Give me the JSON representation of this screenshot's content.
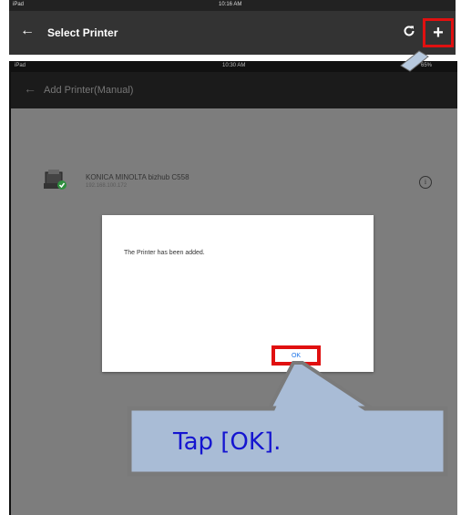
{
  "back_screen": {
    "status_left": "iPad",
    "status_time": "10:16 AM",
    "back_icon": "arrow-left-icon",
    "title": "Select Printer",
    "refresh_icon": "refresh-icon",
    "add_label": "+"
  },
  "front_screen": {
    "status_left": "iPad",
    "status_time": "10:30 AM",
    "status_right": "65%",
    "back_icon": "arrow-left-icon",
    "title": "Add Printer(Manual)",
    "printer": {
      "name": "KONICA MINOLTA bizhub C558",
      "address": "192.168.100.172",
      "icon": "printer-icon",
      "info_icon": "info-icon",
      "info_glyph": "i"
    },
    "dialog": {
      "message": "The Printer has been added.",
      "ok_label": "OK"
    }
  },
  "annotation": {
    "text": "Tap [OK].",
    "highlight_color": "#e01010",
    "callout_fill": "#a9bcd6",
    "text_color": "#1515d0"
  }
}
